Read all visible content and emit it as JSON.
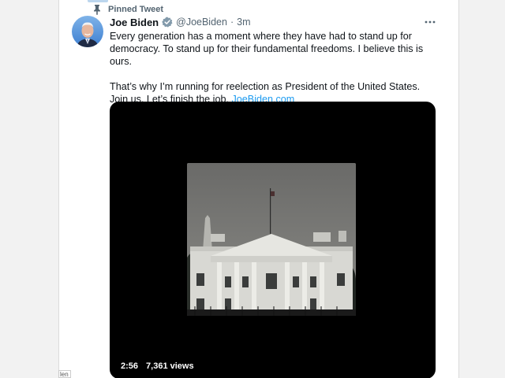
{
  "tweet": {
    "pinned_label": "Pinned Tweet",
    "author": {
      "display_name": "Joe Biden",
      "handle": "@JoeBiden",
      "timestamp": "3m",
      "verified": true
    },
    "text_paragraph_1": "Every generation has a moment where they have had to stand up for democracy. To stand up for their fundamental freedoms. I believe this is ours.",
    "text_paragraph_2": "That’s why I’m running for reelection as President of the United States. Join us. Let’s finish the job.",
    "link": "JoeBiden.com",
    "media": {
      "type": "video",
      "duration": "2:56",
      "views": "7,361 views"
    }
  },
  "page": {
    "bottom_tag": "len"
  },
  "colors": {
    "link": "#1d9bf0",
    "secondary_text": "#536471",
    "primary_text": "#0f1419",
    "verified_badge": "#829aab"
  },
  "icons": [
    "pin-icon",
    "verified-badge-icon",
    "more-options-icon"
  ]
}
